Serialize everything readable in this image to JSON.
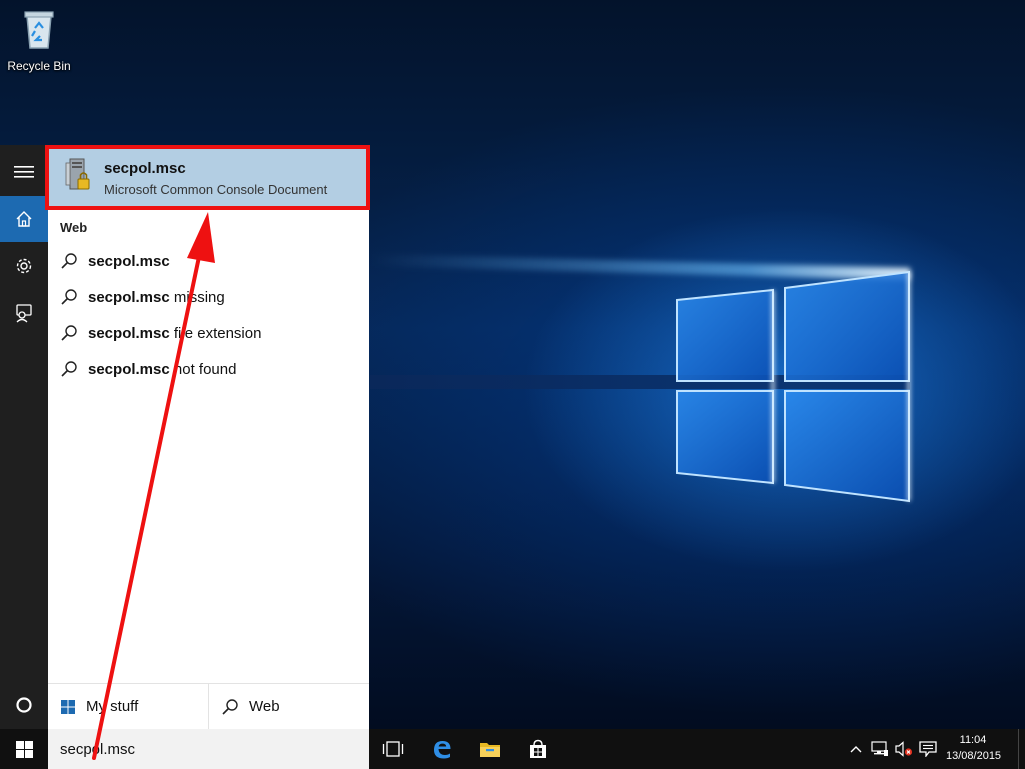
{
  "desktop": {
    "icons": [
      {
        "label": "Recycle Bin",
        "icon": "recycle-bin-icon"
      }
    ]
  },
  "start_rail": {
    "items": [
      {
        "name": "hamburger-menu",
        "icon": "menu-icon"
      },
      {
        "name": "home",
        "icon": "home-icon"
      },
      {
        "name": "settings",
        "icon": "gear-icon"
      },
      {
        "name": "feedback",
        "icon": "feedback-icon"
      },
      {
        "name": "cortana",
        "icon": "circle-icon"
      }
    ]
  },
  "search_results": {
    "best_match": {
      "title": "secpol.msc",
      "subtitle": "Microsoft Common Console Document",
      "icon": "console-document-icon"
    },
    "web_section_label": "Web",
    "web_items": [
      {
        "bold": "secpol.msc",
        "rest": ""
      },
      {
        "bold": "secpol.msc",
        "rest": " missing"
      },
      {
        "bold": "secpol.msc",
        "rest": " file extension"
      },
      {
        "bold": "secpol.msc",
        "rest": " not found"
      }
    ],
    "scope": {
      "my_stuff": "My stuff",
      "web": "Web"
    }
  },
  "taskbar": {
    "search_text": "secpol.msc",
    "pinned": [
      {
        "name": "task-view",
        "icon": "task-view-icon"
      },
      {
        "name": "edge",
        "icon": "edge-icon"
      },
      {
        "name": "file-explorer",
        "icon": "folder-icon"
      },
      {
        "name": "store",
        "icon": "store-icon"
      }
    ],
    "clock": {
      "time": "11:04",
      "date": "13/08/2015"
    }
  },
  "colors": {
    "accent": "#1d6ab1",
    "best_match_bg": "#b3cee3",
    "annotation": "#ee1111"
  }
}
